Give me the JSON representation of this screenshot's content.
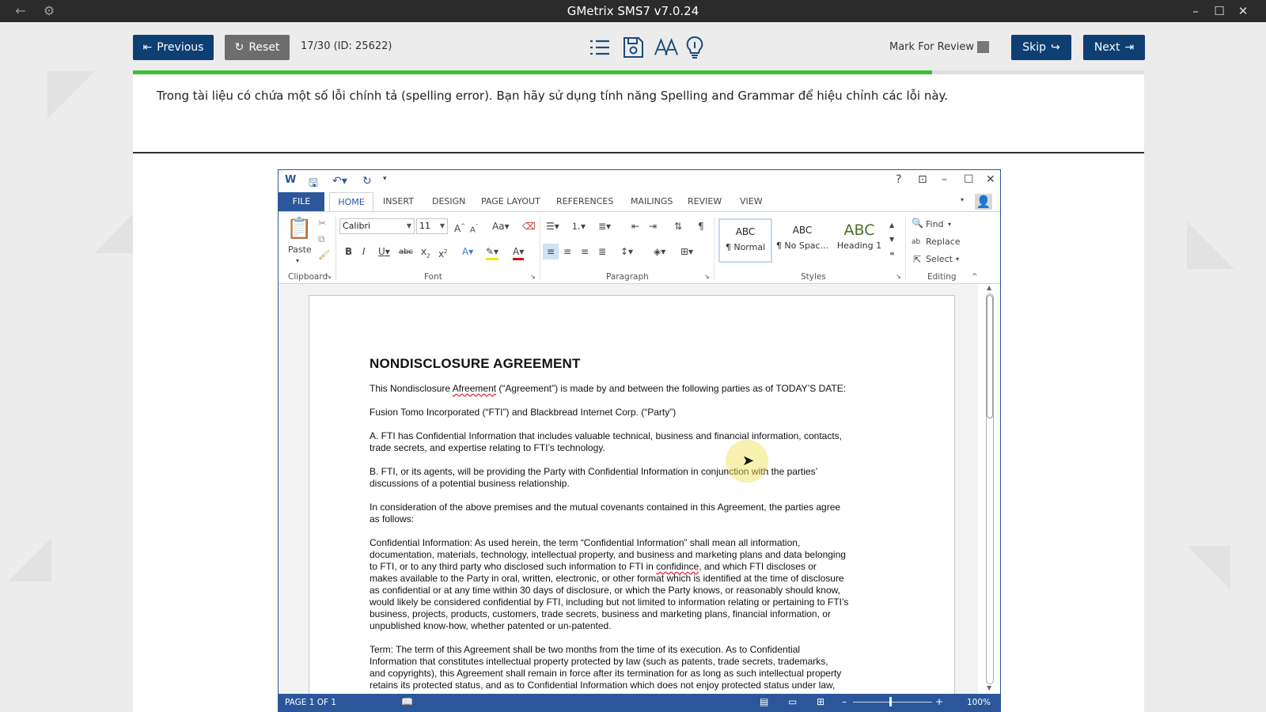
{
  "app": {
    "title": "GMetrix SMS7 v7.0.24"
  },
  "exam": {
    "previous_label": "Previous",
    "reset_label": "Reset",
    "question_counter": "17/30 (ID: 25622)",
    "mark_for_review_label": "Mark For Review",
    "skip_label": "Skip",
    "next_label": "Next",
    "progress": 0.79,
    "question_text": "Trong tài liệu có chứa một số lỗi chính tả (spelling error). Bạn hãy sử dụng tính năng Spelling and Grammar để hiệu chỉnh các lỗi này."
  },
  "word": {
    "tabs": [
      "FILE",
      "HOME",
      "INSERT",
      "DESIGN",
      "PAGE LAYOUT",
      "REFERENCES",
      "MAILINGS",
      "REVIEW",
      "VIEW"
    ],
    "ribbon": {
      "paste_label": "Paste",
      "font_name": "Calibri",
      "font_size": "11",
      "groups": {
        "clipboard": "Clipboard",
        "font": "Font",
        "paragraph": "Paragraph",
        "styles": "Styles",
        "editing": "Editing"
      },
      "styles": [
        {
          "preview": "ABC",
          "name": "¶ Normal"
        },
        {
          "preview": "ABC",
          "name": "¶ No Spac..."
        },
        {
          "preview": "ABC",
          "name": "Heading 1"
        }
      ],
      "find_label": "Find",
      "replace_label": "Replace",
      "select_label": "Select"
    },
    "document": {
      "title": "NONDISCLOSURE AGREEMENT",
      "p1": {
        "before": "This Nondisclosure ",
        "error": "Afreement",
        "after": " (“Agreement”) is made by and between the following parties as of TODAY’S DATE:"
      },
      "p2": "Fusion Tomo Incorporated (“FTI”) and Blackbread Internet Corp. (“Party”)",
      "pA": [
        "A.  FTI has Confidential Information that includes valuable technical, business and financial information, contacts,",
        "trade secrets, and expertise relating to FTI’s technology."
      ],
      "pB": [
        "B.  FTI, or its agents, will be providing the Party with Confidential Information in conjunction with the parties’",
        "discussions of a potential business relationship."
      ],
      "pC": [
        "In consideration of the above premises and the mutual covenants contained in this Agreement, the parties agree",
        "as follows:"
      ],
      "pD": {
        "l1": "Confidential Information:   As used herein, the term “Confidential Information” shall mean all information,",
        "l2": "documentation, materials, technology, intellectual property, and business and marketing plans and data belonging",
        "l3a": "to FTI, or to any third party who disclosed such information to FTI in ",
        "l3err": "confidince",
        "l3b": ", and which FTI discloses or",
        "l4": "makes available to the Party in oral, written, electronic, or other format which is identified at the time of disclosure",
        "l5": "as confidential or at any time within 30 days of disclosure, or which the Party knows, or reasonably should know,",
        "l6": "would likely be considered confidential by FTI, including but not limited to information relating or pertaining to FTI’s",
        "l7": "business, projects, products, customers, trade secrets, business and marketing plans, financial information, or",
        "l8": "unpublished know-how, whether patented or un-patented."
      },
      "pE": [
        "Term:  The term of this Agreement shall be two months from the time of its execution.  As to Confidential",
        "Information that constitutes intellectual property protected  by law (such as patents, trade secrets, trademarks,",
        "and copyrights), this Agreement shall remain in force after its termination for as long as such intellectual property",
        "retains its protected status, and as to Confidential Information which does not enjoy protected status under law,"
      ]
    },
    "status": {
      "page": "PAGE 1 OF 1",
      "zoom": "100%"
    }
  }
}
